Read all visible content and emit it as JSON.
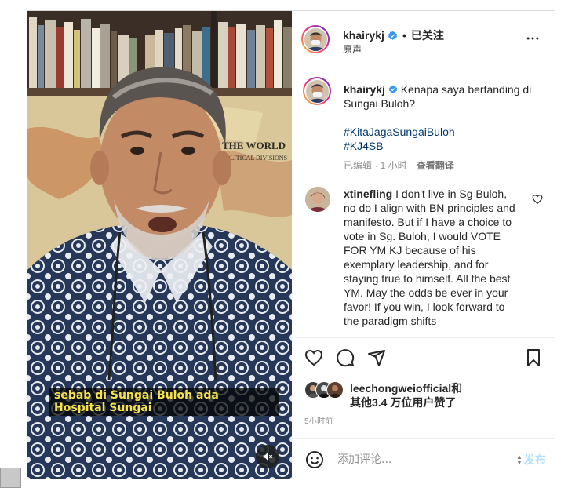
{
  "post": {
    "header": {
      "username": "khairykj",
      "separator": "•",
      "follow_state": "已关注",
      "audio_label": "原声"
    },
    "caption": {
      "username": "khairykj",
      "text": "Kenapa saya bertanding di Sungai Buloh?",
      "hashtags": [
        "#KitaJagaSungaiBuloh",
        "#KJ4SB"
      ],
      "edited_label": "已编辑 · 1 小时",
      "translate_label": "查看翻译"
    },
    "comment": {
      "username": "xtinefling",
      "text": "I don't live in Sg Buloh, no do I align with BN principles and manifesto. But if I have a choice to vote in Sg. Buloh, I would VOTE FOR YM KJ because of his exemplary leadership, and for staying true to himself. All the best YM. May the odds be ever in your favor! If you win, I look forward to the paradigm shifts"
    },
    "likes": {
      "text_line1": "leechongweiofficial和",
      "text_line2": "其他3.4 万位用户赞了"
    },
    "time_ago": "5小时前",
    "comment_box": {
      "placeholder": "添加评论...",
      "post_label": "发布"
    }
  },
  "video": {
    "subtitle": "sebab di Sungai Buloh ada Hospital Sungai",
    "map_title": "THE WORLD",
    "map_subtitle": "POLITICAL DIVISIONS"
  },
  "icons": {
    "verified": "verified-badge-icon",
    "more": "more-horizontal-icon",
    "like": "heart-icon",
    "comment": "comment-bubble-icon",
    "share": "paper-plane-icon",
    "save": "bookmark-icon",
    "emoji": "smiley-icon",
    "mute": "speaker-muted-icon"
  },
  "colors": {
    "accent_blue": "#0095f6",
    "verified_blue": "#3897f0",
    "hashtag": "#00376b",
    "subtitle_yellow": "#f7e34b",
    "muted_text": "#8e8e8e"
  }
}
